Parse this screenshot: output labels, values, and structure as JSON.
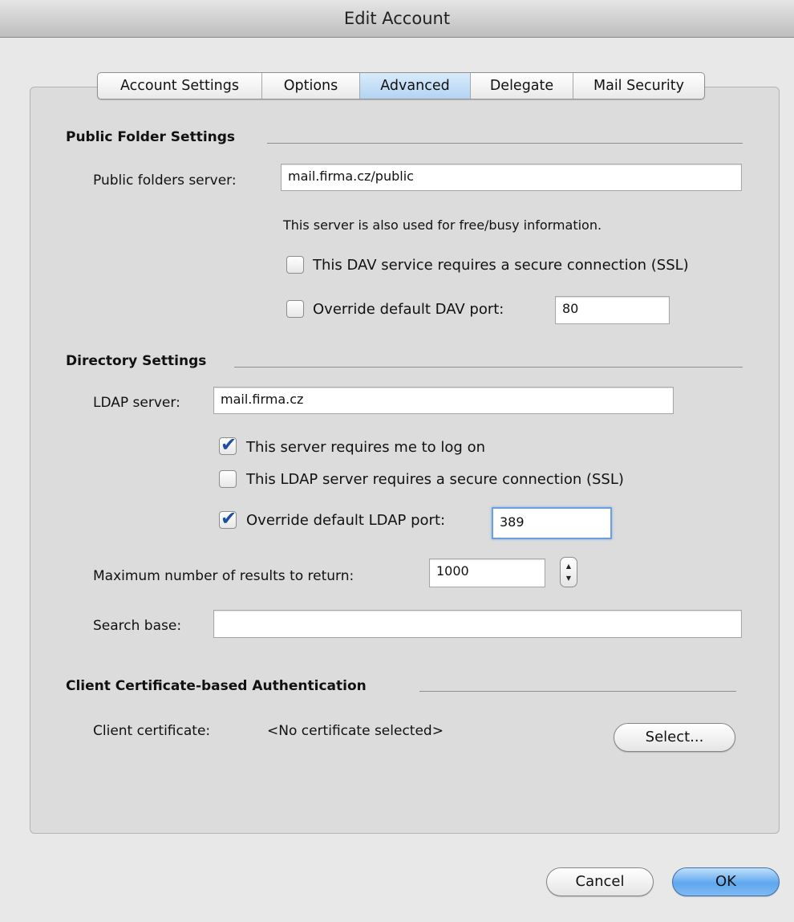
{
  "window": {
    "title": "Edit Account"
  },
  "tabs": [
    {
      "label": "Account Settings",
      "active": false
    },
    {
      "label": "Options",
      "active": false
    },
    {
      "label": "Advanced",
      "active": true
    },
    {
      "label": "Delegate",
      "active": false
    },
    {
      "label": "Mail Security",
      "active": false
    }
  ],
  "public_folder": {
    "heading": "Public Folder Settings",
    "server_label": "Public folders server:",
    "server_value": "mail.firma.cz/public",
    "info_text": "This server is also used for free/busy information.",
    "ssl_label": "This DAV service requires a secure connection (SSL)",
    "ssl_checked": false,
    "port_label": "Override default DAV port:",
    "port_checked": false,
    "port_value": "80"
  },
  "directory": {
    "heading": "Directory Settings",
    "ldap_label": "LDAP server:",
    "ldap_value": "mail.firma.cz",
    "logon_label": "This server requires me to log on",
    "logon_checked": true,
    "ssl_label": "This LDAP server requires a secure connection (SSL)",
    "ssl_checked": false,
    "port_label": "Override default LDAP port:",
    "port_checked": true,
    "port_value": "389",
    "max_results_label": "Maximum number of results to return:",
    "max_results_value": "1000",
    "search_base_label": "Search base:",
    "search_base_value": ""
  },
  "certificate": {
    "heading": "Client Certificate-based Authentication",
    "label": "Client certificate:",
    "value": "<No certificate selected>",
    "select_button": "Select..."
  },
  "footer": {
    "cancel": "Cancel",
    "ok": "OK"
  },
  "icons": {
    "checkmark": "✔",
    "stepper_up": "▲",
    "stepper_down": "▼"
  },
  "colors": {
    "accent": "#5fa6ee",
    "focus": "#6d9fe0",
    "check": "#1f4fa0"
  }
}
